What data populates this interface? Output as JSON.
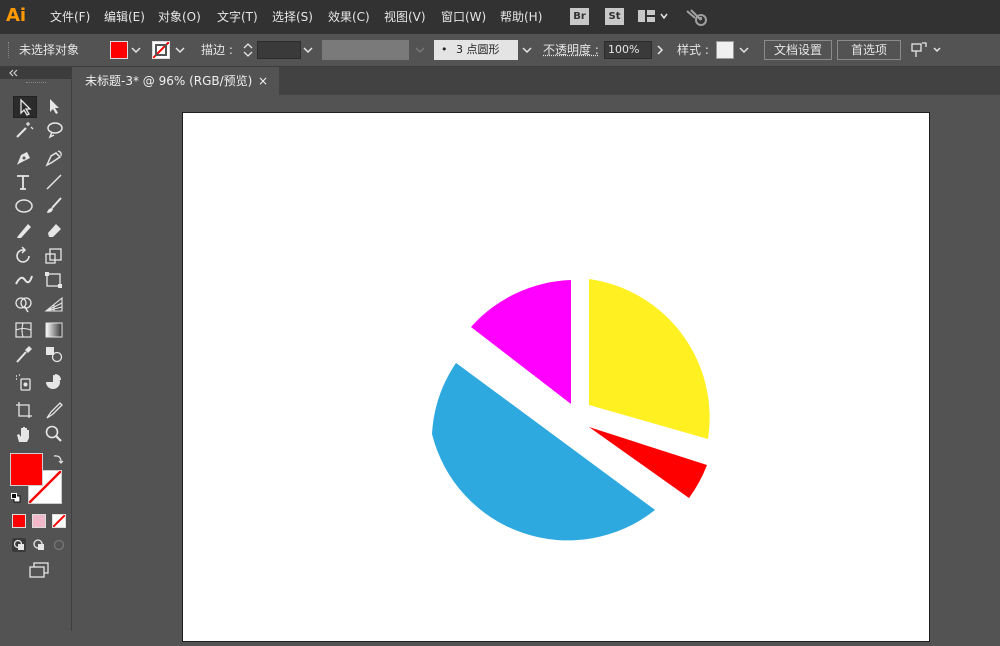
{
  "app": {
    "logo": "Ai",
    "accent": "#ff9a00"
  },
  "menu": [
    "文件(F)",
    "编辑(E)",
    "对象(O)",
    "文字(T)",
    "选择(S)",
    "效果(C)",
    "视图(V)",
    "窗口(W)",
    "帮助(H)"
  ],
  "app_buttons": {
    "bridge": "Br",
    "stock": "St"
  },
  "control_bar": {
    "selection_status": "未选择对象",
    "fill_color": "#ff0000",
    "stroke_label": "描边 :",
    "brush_value": "3 点圆形",
    "opacity_label": "不透明度 :",
    "opacity_value": "100%",
    "style_label": "样式 :",
    "doc_setup_label": "文档设置",
    "prefs_label": "首选项"
  },
  "document": {
    "tab_title": "未标题-3* @ 96% (RGB/预览)",
    "close_glyph": "×"
  },
  "toolbar": {
    "fill_color": "#ff0000",
    "stroke_color": "#ffffff"
  },
  "artwork": {
    "description_colors": {
      "cyan": "#2ea9df",
      "magenta": "#ff00ff",
      "yellow": "#fff021",
      "red": "#ff0000"
    }
  }
}
